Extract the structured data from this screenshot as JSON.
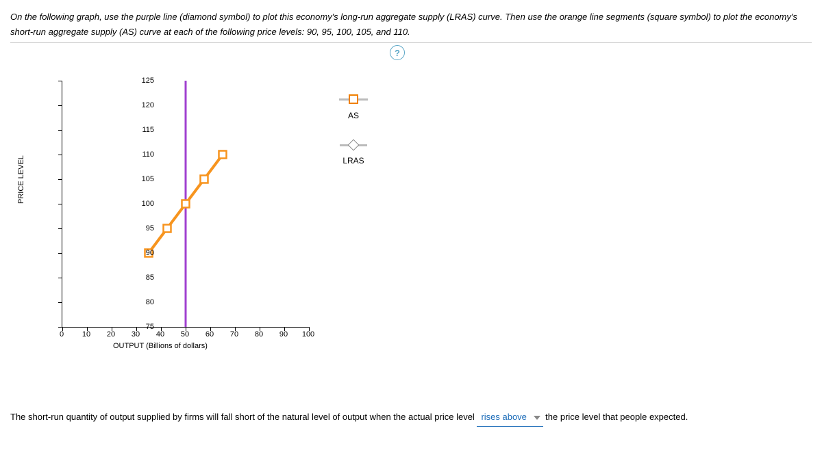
{
  "instructions": "On the following graph, use the purple line (diamond symbol) to plot this economy's long-run aggregate supply (LRAS) curve. Then use the orange line segments (square symbol) to plot the economy's short-run aggregate supply (AS) curve at each of the following price levels: 90, 95, 100, 105, and 110.",
  "help_label": "?",
  "legend": {
    "as": "AS",
    "lras": "LRAS"
  },
  "sentence": {
    "part1": "The short-run quantity of output supplied by firms will fall short of the natural level of output when the actual price level",
    "selected": "rises above",
    "part2": "the price level that people expected."
  },
  "chart_data": {
    "type": "line",
    "xlabel": "OUTPUT (Billions of dollars)",
    "ylabel": "PRICE LEVEL",
    "xlim": [
      0,
      100
    ],
    "ylim": [
      75,
      125
    ],
    "x_ticks": [
      0,
      10,
      20,
      30,
      40,
      50,
      60,
      70,
      80,
      90,
      100
    ],
    "y_ticks": [
      75,
      80,
      85,
      90,
      95,
      100,
      105,
      110,
      115,
      120,
      125
    ],
    "series": [
      {
        "name": "LRAS",
        "type": "vertical-line",
        "color": "#a040d0",
        "x": 50,
        "y_from": 75,
        "y_to": 125
      },
      {
        "name": "AS",
        "type": "line-with-squares",
        "color": "#f7941e",
        "points": [
          {
            "x": 35,
            "y": 90
          },
          {
            "x": 42.5,
            "y": 95
          },
          {
            "x": 50,
            "y": 100
          },
          {
            "x": 57.5,
            "y": 105
          },
          {
            "x": 65,
            "y": 110
          }
        ]
      }
    ]
  }
}
